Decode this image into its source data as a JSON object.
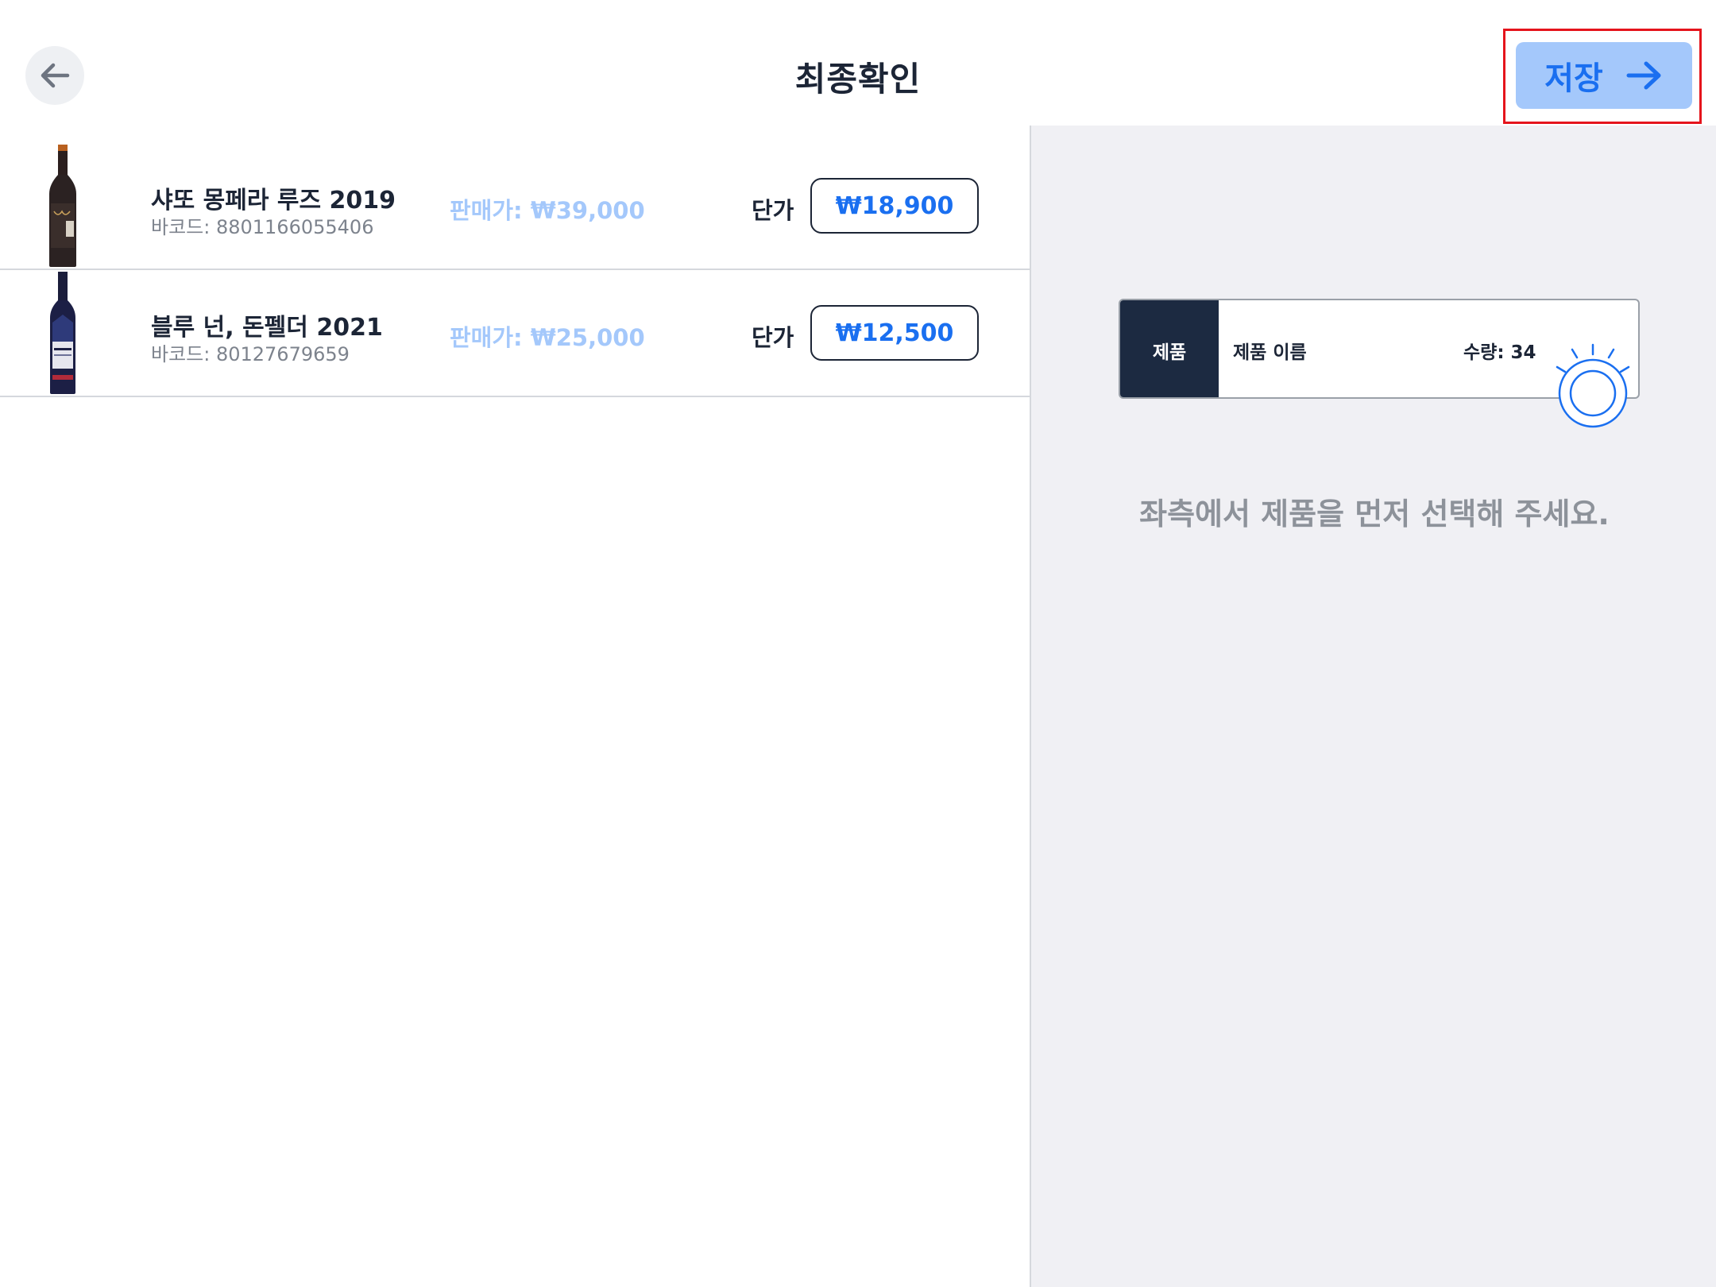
{
  "header": {
    "title": "최종확인",
    "save_label": "저장",
    "back_icon": "arrow-left-icon",
    "save_icon": "arrow-right-icon"
  },
  "products": [
    {
      "name": "샤또 몽페라 루즈 2019",
      "barcode": "바코드: 8801166055406",
      "sale_price": "판매가: ₩39,000",
      "unit_label": "단가",
      "unit_price": "₩18,900"
    },
    {
      "name": "블루 넌, 돈펠더 2021",
      "barcode": "바코드: 80127679659",
      "sale_price": "판매가: ₩25,000",
      "unit_label": "단가",
      "unit_price": "₩12,500"
    }
  ],
  "detail": {
    "illustration": {
      "tag": "제품",
      "name": "제품 이름",
      "quantity": "수량: 34"
    },
    "empty_message": "좌측에서 제품을 먼저 선택해 주세요."
  },
  "colors": {
    "accent": "#1a6ff0",
    "accent_light": "#a4c8fb",
    "text_dark": "#1c2536",
    "panel_bg": "#f0f0f4",
    "highlight": "#e5141c"
  }
}
